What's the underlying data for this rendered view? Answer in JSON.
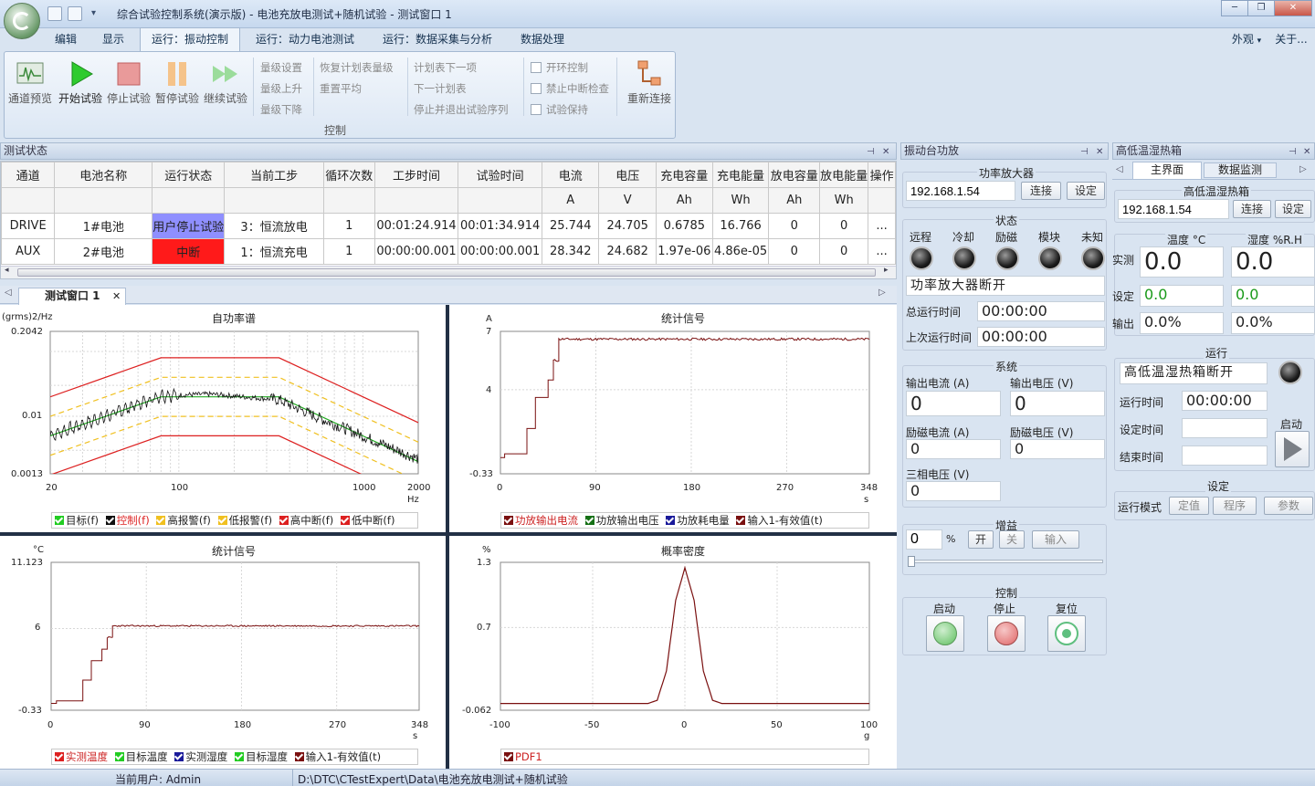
{
  "window": {
    "title": "综合试验控制系统(演示版) - 电池充放电测试+随机试验 - 测试窗口 1",
    "controls": [
      "─",
      "❐",
      "✕"
    ]
  },
  "ribbon_tabs": [
    "编辑",
    "显示",
    "运行：振动控制",
    "运行：动力电池测试",
    "运行：数据采集与分析",
    "数据处理"
  ],
  "ribbon_right": [
    "外观",
    "关于..."
  ],
  "ribbon": {
    "big_buttons": [
      "通道预览",
      "开始试验",
      "停止试验",
      "暂停试验",
      "继续试验"
    ],
    "col1": [
      "量级设置",
      "量级上升",
      "量级下降"
    ],
    "col2": [
      "恢复计划表量级",
      "重置平均"
    ],
    "col3": [
      "计划表下一项",
      "下一计划表",
      "停止并退出试验序列"
    ],
    "checks": [
      "开环控制",
      "禁止中断检查",
      "试验保持"
    ],
    "reconnect": "重新连接",
    "group_label": "控制"
  },
  "test_status": {
    "title": "测试状态",
    "headers": [
      "通道",
      "电池名称",
      "运行状态",
      "当前工步",
      "循环次数",
      "工步时间",
      "试验时间",
      "电流",
      "电压",
      "充电容量",
      "充电能量",
      "放电容量",
      "放电能量",
      "操作"
    ],
    "units": [
      "",
      "",
      "",
      "",
      "",
      "",
      "",
      "A",
      "V",
      "Ah",
      "Wh",
      "Ah",
      "Wh",
      ""
    ],
    "rows": [
      {
        "cells": [
          "DRIVE",
          "1#电池",
          "用户停止试验",
          "3：恒流放电",
          "1",
          "00:01:24.914",
          "00:01:34.914",
          "25.744",
          "24.705",
          "0.6785",
          "16.766",
          "0",
          "0",
          "..."
        ],
        "status_color": "#8f8fff"
      },
      {
        "cells": [
          "AUX",
          "2#电池",
          "中断",
          "1：恒流充电",
          "1",
          "00:00:00.001",
          "00:00:00.001",
          "28.342",
          "24.682",
          "1.97e-06",
          "4.86e-05",
          "0",
          "0",
          "..."
        ],
        "status_color": "#ff1a1a"
      }
    ]
  },
  "doc_tab": "测试窗口 1",
  "charts": {
    "psd": {
      "title": "自功率谱",
      "ylabel": "(grms)2/Hz",
      "xunit": "Hz",
      "ytick_labels": [
        "0.2042",
        "0.01",
        "0.0013"
      ],
      "xtick_labels": [
        "20",
        "100",
        "1000",
        "2000"
      ],
      "legend": [
        {
          "label": "目标(f)",
          "color": "#22cc22"
        },
        {
          "label": "控制(f)",
          "color": "#111111"
        },
        {
          "label": "高报警(f)",
          "color": "#f0c020"
        },
        {
          "label": "低报警(f)",
          "color": "#f0c020"
        },
        {
          "label": "高中断(f)",
          "color": "#dd2020"
        },
        {
          "label": "低中断(f)",
          "color": "#dd2020"
        }
      ]
    },
    "stat1": {
      "title": "统计信号",
      "ylabel": "A",
      "xunit": "s",
      "ytick_labels": [
        "7",
        "4",
        "-0.33"
      ],
      "xtick_labels": [
        "0",
        "90",
        "180",
        "270",
        "348"
      ],
      "legend": [
        {
          "label": "功放输出电流",
          "color": "#7a1010"
        },
        {
          "label": "功放输出电压",
          "color": "#157015"
        },
        {
          "label": "功放耗电量",
          "color": "#1a1a9a"
        },
        {
          "label": "输入1-有效值(t)",
          "color": "#7a1010"
        }
      ]
    },
    "stat2": {
      "title": "统计信号",
      "ylabel": "°C",
      "xunit": "s",
      "ytick_labels": [
        "11.123",
        "6",
        "-0.33"
      ],
      "xtick_labels": [
        "0",
        "90",
        "180",
        "270",
        "348"
      ],
      "legend": [
        {
          "label": "实测温度",
          "color": "#dd2020"
        },
        {
          "label": "目标温度",
          "color": "#22cc22"
        },
        {
          "label": "实测湿度",
          "color": "#1a1a9a"
        },
        {
          "label": "目标湿度",
          "color": "#22cc22"
        },
        {
          "label": "输入1-有效值(t)",
          "color": "#7a1010"
        }
      ]
    },
    "pdf": {
      "title": "概率密度",
      "ylabel": "%",
      "xunit": "g",
      "ytick_labels": [
        "1.3",
        "0.7",
        "-0.062"
      ],
      "xtick_labels": [
        "-100",
        "-50",
        "0",
        "50",
        "100"
      ],
      "legend": [
        {
          "label": "PDF1",
          "color": "#7a1010"
        }
      ]
    }
  },
  "chart_data": [
    {
      "type": "line",
      "title": "自功率谱",
      "ylabel": "(grms)2/Hz",
      "xlabel": "Hz",
      "x_scale": "log",
      "y_scale": "log",
      "xlim": [
        20,
        2000
      ],
      "ylim": [
        0.0013,
        0.2042
      ],
      "series": [
        {
          "name": "目标(f)",
          "x": [
            20,
            80,
            350,
            2000
          ],
          "y": [
            0.005,
            0.02,
            0.02,
            0.002
          ]
        },
        {
          "name": "控制(f)",
          "x": [
            20,
            40,
            80,
            150,
            350,
            600,
            1000,
            2000
          ],
          "y": [
            0.005,
            0.01,
            0.021,
            0.022,
            0.018,
            0.009,
            0.005,
            0.0022
          ]
        },
        {
          "name": "高报警(f)",
          "x": [
            20,
            80,
            350,
            2000
          ],
          "y": [
            0.01,
            0.04,
            0.04,
            0.004
          ]
        },
        {
          "name": "低报警(f)",
          "x": [
            20,
            80,
            350,
            2000
          ],
          "y": [
            0.0025,
            0.01,
            0.01,
            0.001
          ]
        },
        {
          "name": "高中断(f)",
          "x": [
            20,
            80,
            350,
            2000
          ],
          "y": [
            0.02,
            0.08,
            0.08,
            0.008
          ]
        },
        {
          "name": "低中断(f)",
          "x": [
            20,
            80,
            350,
            2000
          ],
          "y": [
            0.00125,
            0.005,
            0.005,
            0.0005
          ]
        }
      ]
    },
    {
      "type": "line",
      "title": "统计信号",
      "ylabel": "A",
      "xlabel": "s",
      "xlim": [
        0,
        348
      ],
      "ylim": [
        -0.33,
        7
      ],
      "series": [
        {
          "name": "功放输出电流",
          "x": [
            0,
            4,
            4,
            25,
            25,
            33,
            33,
            45,
            45,
            50,
            50,
            55,
            55,
            348
          ],
          "y": [
            0.5,
            0.5,
            0.7,
            0.7,
            2.0,
            2.0,
            3.6,
            3.6,
            4.5,
            4.5,
            5.5,
            5.5,
            6.6,
            6.6
          ]
        }
      ]
    },
    {
      "type": "line",
      "title": "统计信号",
      "ylabel": "°C",
      "xlabel": "s",
      "xlim": [
        0,
        348
      ],
      "ylim": [
        -0.33,
        11.123
      ],
      "series": [
        {
          "name": "输入1-有效值(t)",
          "x": [
            0,
            5,
            5,
            30,
            30,
            38,
            38,
            48,
            48,
            53,
            53,
            58,
            58,
            348
          ],
          "y": [
            0.2,
            0.2,
            0.4,
            0.4,
            2.0,
            2.0,
            3.5,
            3.5,
            4.4,
            4.4,
            5.3,
            5.3,
            6.2,
            6.2
          ]
        }
      ]
    },
    {
      "type": "line",
      "title": "概率密度",
      "ylabel": "%",
      "xlabel": "g",
      "xlim": [
        -100,
        100
      ],
      "ylim": [
        -0.062,
        1.3
      ],
      "series": [
        {
          "name": "PDF1",
          "x": [
            -100,
            -20,
            -15,
            -10,
            -5,
            0,
            5,
            10,
            15,
            20,
            100
          ],
          "y": [
            0.0,
            0.0,
            0.03,
            0.3,
            0.95,
            1.25,
            0.95,
            0.3,
            0.03,
            0.0,
            0.0
          ]
        }
      ]
    }
  ],
  "amp_panel": {
    "title": "振动台功放",
    "amp_group": "功率放大器",
    "ip": "192.168.1.54",
    "connect": "连接",
    "settings": "设定",
    "state_group": "状态",
    "lamps": [
      "远程",
      "冷却",
      "励磁",
      "模块",
      "未知"
    ],
    "status_text": "功率放大器断开",
    "total_run_label": "总运行时间",
    "total_run": "00:00:00",
    "last_run_label": "上次运行时间",
    "last_run": "00:00:00",
    "system_group": "系统",
    "out_current_label": "输出电流 (A)",
    "out_current": "0",
    "out_voltage_label": "输出电压 (V)",
    "out_voltage": "0",
    "exc_current_label": "励磁电流 (A)",
    "exc_current": "0",
    "exc_voltage_label": "励磁电压 (V)",
    "exc_voltage": "0",
    "three_phase_label": "三相电压 (V)",
    "three_phase": "0",
    "gain_group": "增益",
    "gain_value": "0",
    "gain_unit": "%",
    "gain_on": "开",
    "gain_off": "关",
    "gain_input": "输入",
    "control_group": "控制",
    "start_label": "启动",
    "stop_label": "停止",
    "reset_label": "复位"
  },
  "chamber_panel": {
    "title": "高低温湿热箱",
    "tabs": [
      "主界面",
      "数据监测"
    ],
    "group": "高低温湿热箱",
    "ip": "192.168.1.54",
    "connect": "连接",
    "settings": "设定",
    "temp_header": "温度 °C",
    "hum_header": "湿度 %R.H",
    "actual_label": "实测",
    "set_label": "设定",
    "output_label": "输出",
    "temp_actual": "0.0",
    "hum_actual": "0.0",
    "temp_set": "0.0",
    "hum_set": "0.0",
    "temp_out": "0.0%",
    "hum_out": "0.0%",
    "run_group": "运行",
    "status_text": "高低温湿热箱断开",
    "run_time_label": "运行时间",
    "run_time": "00:00:00",
    "set_time_label": "设定时间",
    "end_time_label": "结束时间",
    "start_label": "启动",
    "settings_group": "设定",
    "mode_label": "运行模式",
    "mode_fixed": "定值",
    "mode_program": "程序",
    "params": "参数"
  },
  "statusbar": {
    "user": "当前用户: Admin",
    "path": "D:\\DTC\\CTestExpert\\Data\\电池充放电测试+随机试验"
  }
}
